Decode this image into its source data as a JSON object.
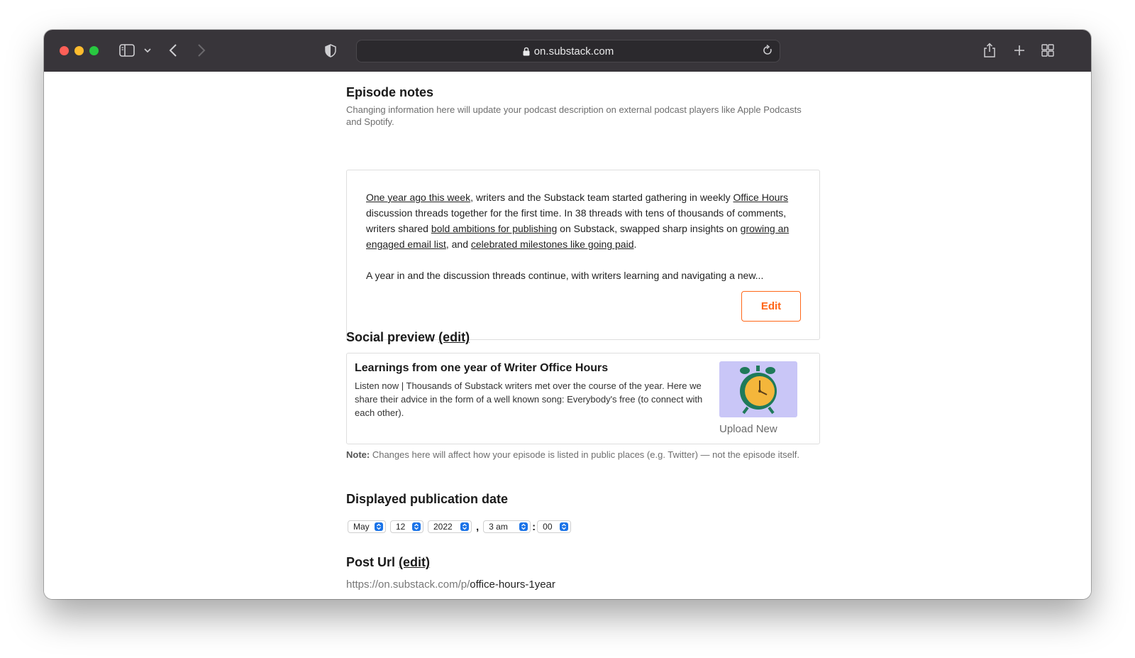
{
  "browser": {
    "address": "on.substack.com"
  },
  "episode_notes": {
    "heading": "Episode notes",
    "description": "Changing information here will update your podcast description on external podcast players like Apple Podcasts and Spotify.",
    "para1": {
      "link1": "One year ago this week",
      "text1": ", writers and the Substack team started gathering in weekly ",
      "link2": "Office Hours",
      "text2": " discussion threads together for the first time. In 38 threads with tens of thousands of comments, writers shared ",
      "link3": "bold ambitions for publishing",
      "text3": " on Substack, swapped sharp insights on ",
      "link4": "growing an engaged email list",
      "text4": ", and ",
      "link5": "celebrated milestones like going paid",
      "text5": "."
    },
    "para2": "A year in and the discussion threads continue, with writers learning and navigating a new...",
    "edit_label": "Edit"
  },
  "social_preview": {
    "heading": "Social preview",
    "edit_link": "(edit)",
    "title": "Learnings from one year of Writer Office Hours",
    "description": "Listen now | Thousands of Substack writers met over the course of the year. Here we share their advice in the form of a well known song: Everybody's free (to connect with each other).",
    "upload_label": "Upload New",
    "note_label": "Note:",
    "note_text": " Changes here will affect how your episode is listed in public places (e.g. Twitter) — not the episode itself."
  },
  "publication_date": {
    "heading": "Displayed publication date",
    "month": "May",
    "day": "12",
    "year": "2022",
    "comma": ",",
    "hour": "3 am",
    "colon": ":",
    "minute": "00"
  },
  "post_url": {
    "heading": "Post Url",
    "edit_link": "(edit)",
    "base": "https://on.substack.com/p/",
    "slug": "office-hours-1year"
  },
  "colors": {
    "accent": "#ff6719",
    "toolbar": "#38353a",
    "select_arrow": "#1a73e8"
  }
}
